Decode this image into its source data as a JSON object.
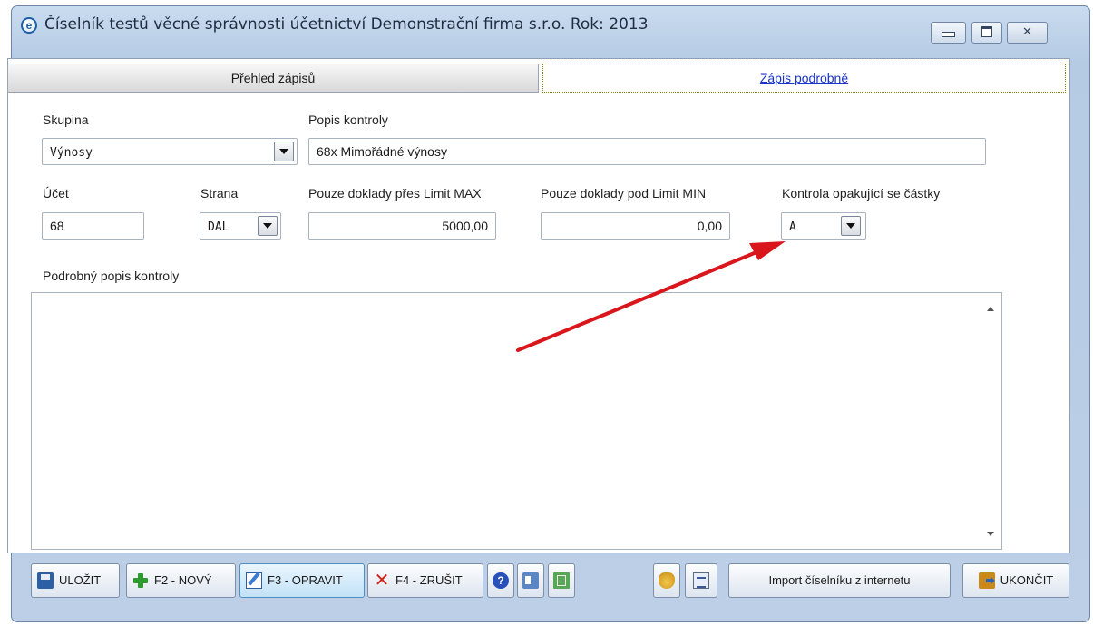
{
  "window": {
    "title": "Číselník testů věcné správnosti účetnictví  Demonstrační firma s.r.o.  Rok: 2013",
    "app_icon_glyph": "e"
  },
  "tabs": [
    {
      "label": "Přehled zápisů"
    },
    {
      "label": "Zápis podrobně"
    }
  ],
  "form": {
    "skupina_label": "Skupina",
    "skupina_value": "Výnosy",
    "popis_label": "Popis kontroly",
    "popis_value": "68x Mimořádné výnosy",
    "ucet_label": "Účet",
    "ucet_value": "68",
    "strana_label": "Strana",
    "strana_value": "DAL",
    "limit_max_label": "Pouze doklady přes Limit MAX",
    "limit_max_value": "5000,00",
    "limit_min_label": "Pouze doklady pod Limit MIN",
    "limit_min_value": "0,00",
    "opak_label": "Kontrola opakující se částky",
    "opak_value": "A",
    "podrobny_label": "Podrobný popis kontroly",
    "podrobny_value": ""
  },
  "toolbar": {
    "save": "ULOŽIT",
    "new": "F2 - NOVÝ",
    "edit": "F3 - OPRAVIT",
    "cancel": "F4 - ZRUŠIT",
    "import": "Import číselníku z internetu",
    "exit": "UKONČIT",
    "help_glyph": "?"
  },
  "annotation": {
    "arrow_color": "#d8161c"
  }
}
